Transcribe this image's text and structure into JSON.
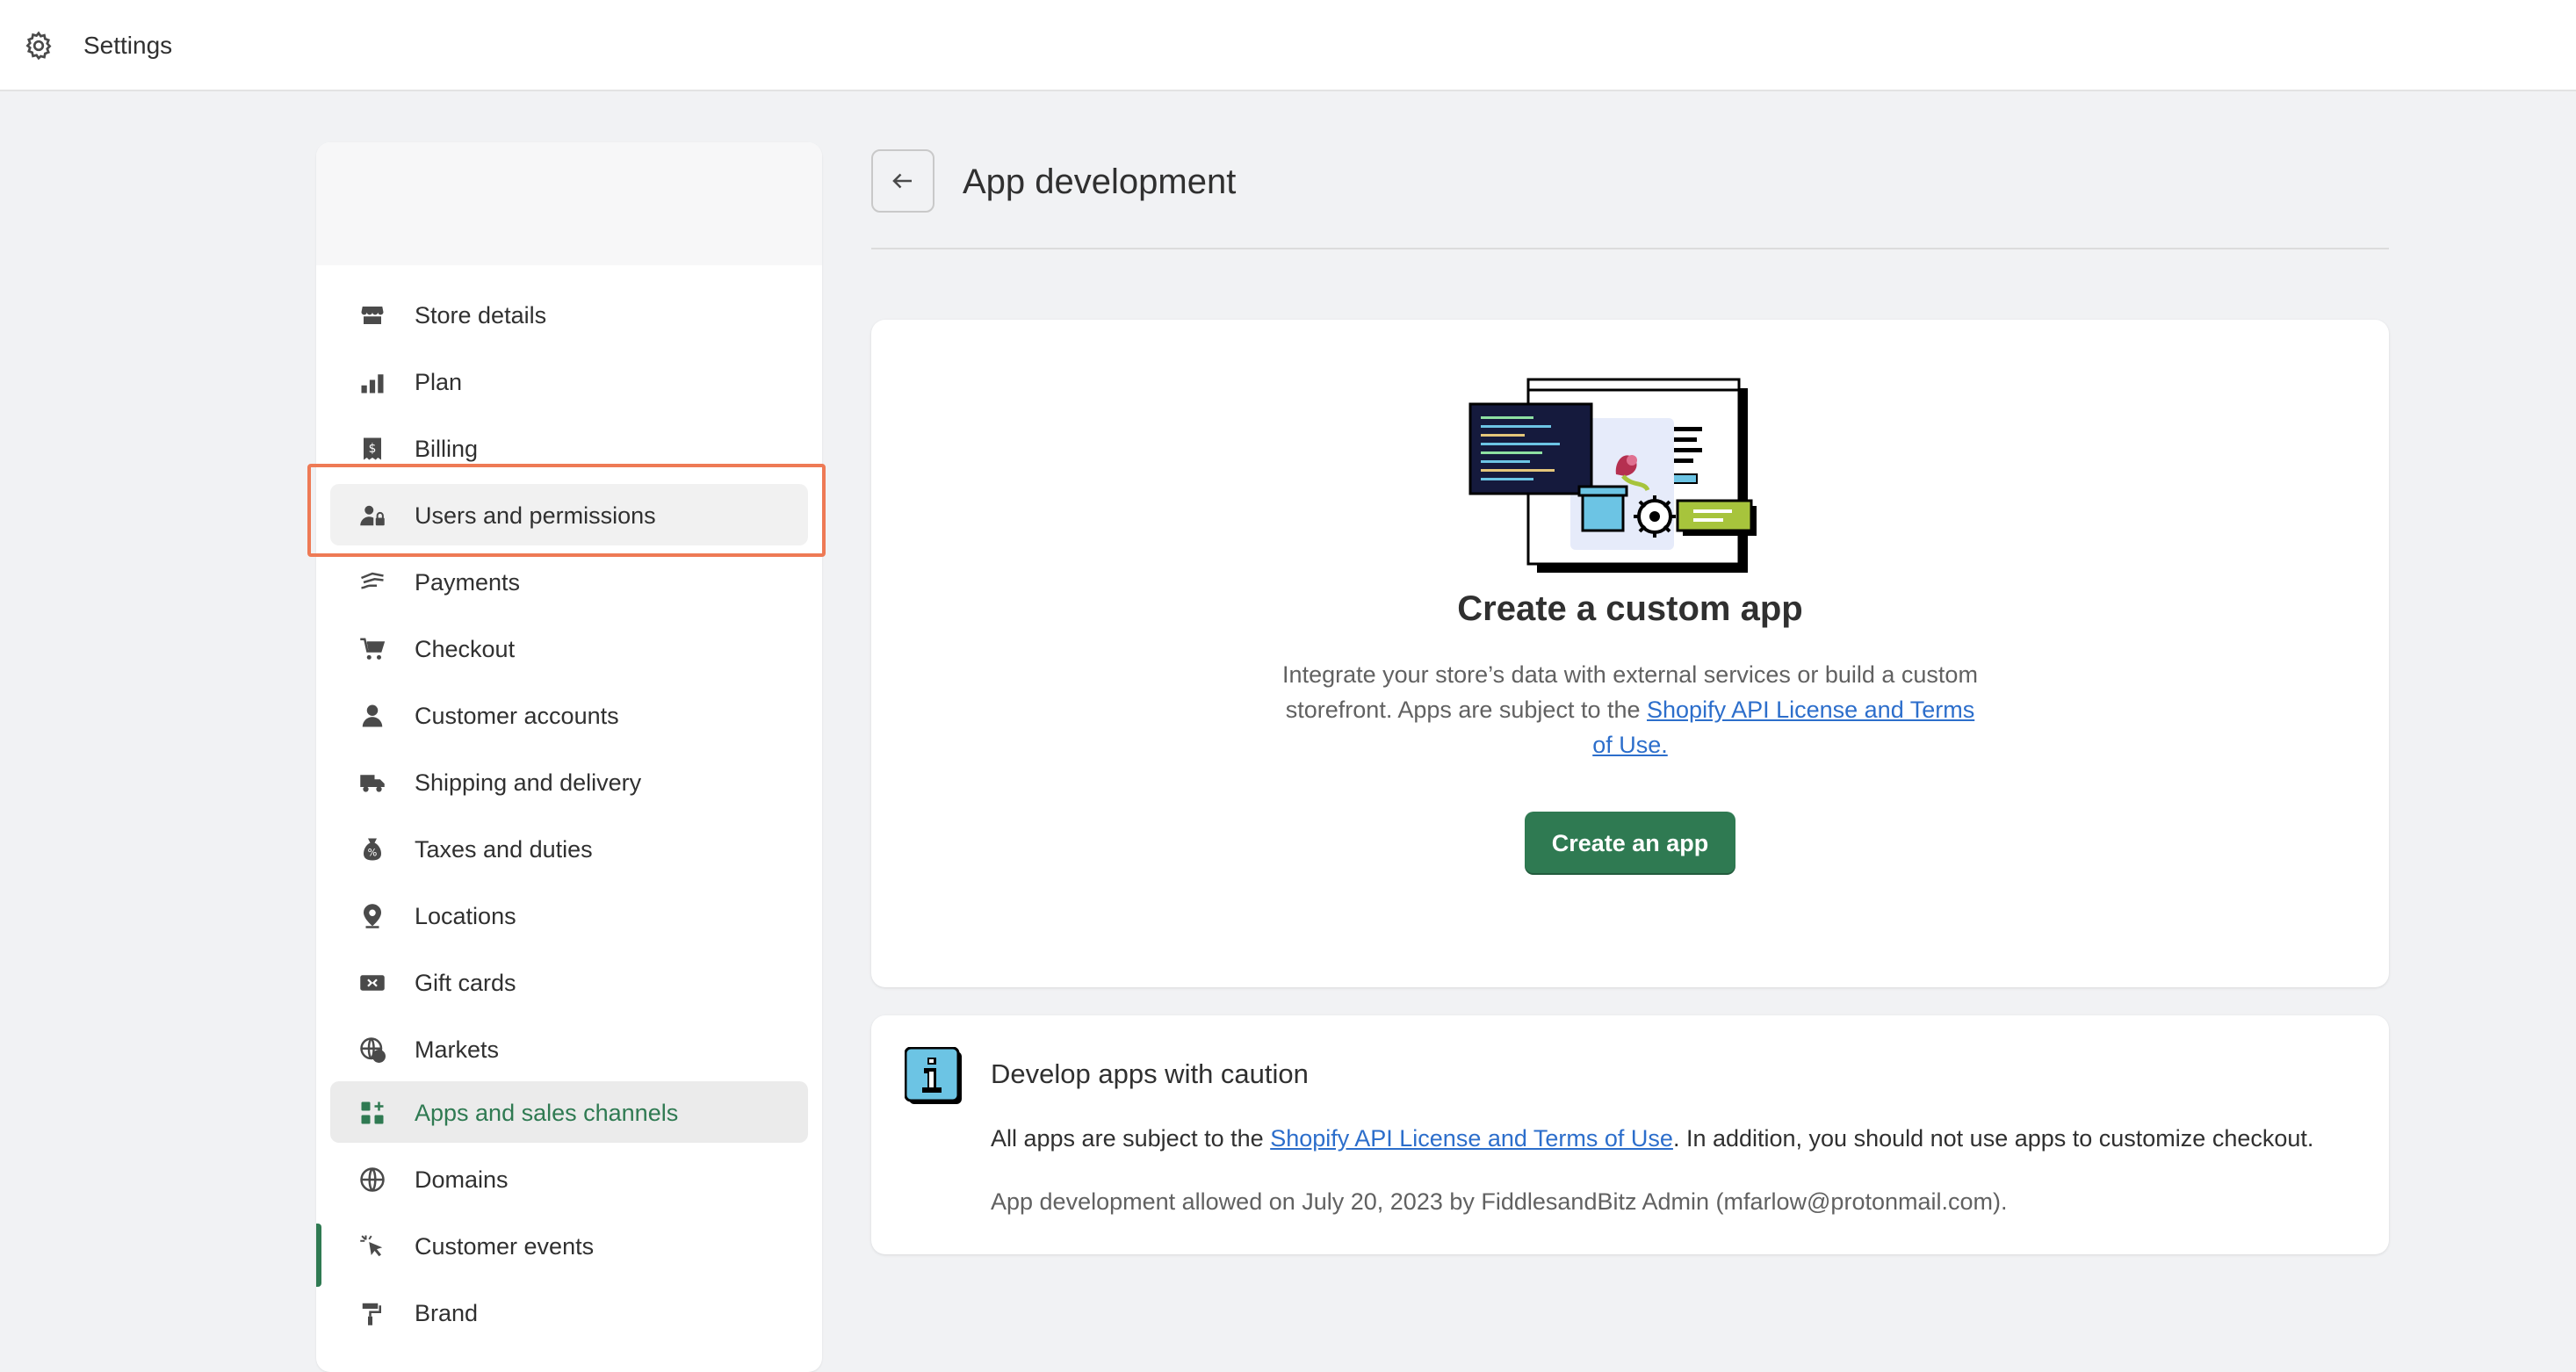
{
  "topbar": {
    "title": "Settings",
    "icon": "gear-icon"
  },
  "sidebar": {
    "items": [
      {
        "label": "Store details",
        "icon": "store-icon"
      },
      {
        "label": "Plan",
        "icon": "plan-icon"
      },
      {
        "label": "Billing",
        "icon": "billing-icon"
      },
      {
        "label": "Users and permissions",
        "icon": "user-lock-icon"
      },
      {
        "label": "Payments",
        "icon": "payments-icon"
      },
      {
        "label": "Checkout",
        "icon": "cart-icon"
      },
      {
        "label": "Customer accounts",
        "icon": "person-icon"
      },
      {
        "label": "Shipping and delivery",
        "icon": "truck-icon"
      },
      {
        "label": "Taxes and duties",
        "icon": "tax-bag-icon"
      },
      {
        "label": "Locations",
        "icon": "location-pin-icon"
      },
      {
        "label": "Gift cards",
        "icon": "gift-card-icon"
      },
      {
        "label": "Markets",
        "icon": "globe-dollar-icon"
      },
      {
        "label": "Apps and sales channels",
        "icon": "apps-grid-icon"
      },
      {
        "label": "Domains",
        "icon": "globe-icon"
      },
      {
        "label": "Customer events",
        "icon": "cursor-click-icon"
      },
      {
        "label": "Brand",
        "icon": "brand-icon"
      }
    ],
    "active": "Apps and sales channels",
    "highlighted": "Users and permissions",
    "accent": "#2f7a52"
  },
  "main": {
    "title": "App development",
    "card1": {
      "title": "Create a custom app",
      "desc_prefix": "Integrate your store’s data with external services or build a custom storefront. Apps are subject to the ",
      "desc_link": "Shopify API License and Terms of Use.",
      "button": "Create an app"
    },
    "card2": {
      "title": "Develop apps with caution",
      "text_prefix": "All apps are subject to the ",
      "text_link": "Shopify API License and Terms of Use",
      "text_suffix": ". In addition, you should not use apps to customize checkout.",
      "note": "App development allowed on July 20, 2023 by FiddlesandBitz Admin (mfarlow@protonmail.com)."
    }
  },
  "colors": {
    "primary_button": "#2f7a52",
    "link": "#2c6ecb",
    "highlight": "#ee7a55"
  }
}
